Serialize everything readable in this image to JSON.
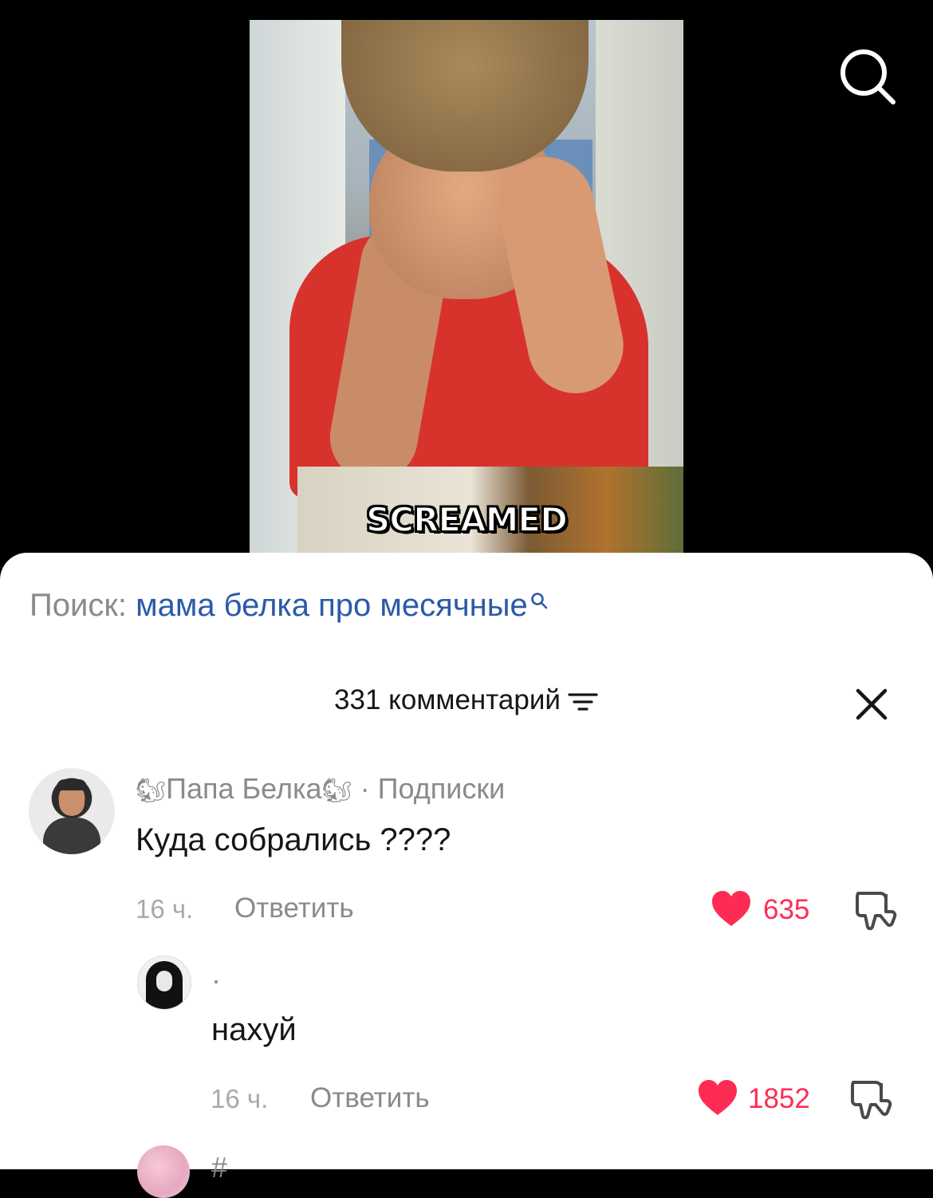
{
  "video": {
    "caption": "SCREAMED",
    "search_icon": "search-icon"
  },
  "sheet": {
    "search_prefix": "Поиск:",
    "search_query": "мама белка про месячные",
    "comments_count_label": "331 комментарий",
    "filter_icon": "sort-icon",
    "close_icon": "close-icon"
  },
  "comments": [
    {
      "author": "Папа Белка",
      "author_emoji": "🐿",
      "relation": "· Подписки",
      "text": "Куда собрались ????",
      "time": "16 ч.",
      "reply_label": "Ответить",
      "likes": "635"
    },
    {
      "author": "·",
      "text": "нахуй",
      "time": "16 ч.",
      "reply_label": "Ответить",
      "likes": "1852"
    },
    {
      "author": "#"
    }
  ],
  "colors": {
    "like_red": "#fe2c55",
    "query_blue": "#2b5aa8",
    "muted_gray": "#8a8a8a"
  }
}
